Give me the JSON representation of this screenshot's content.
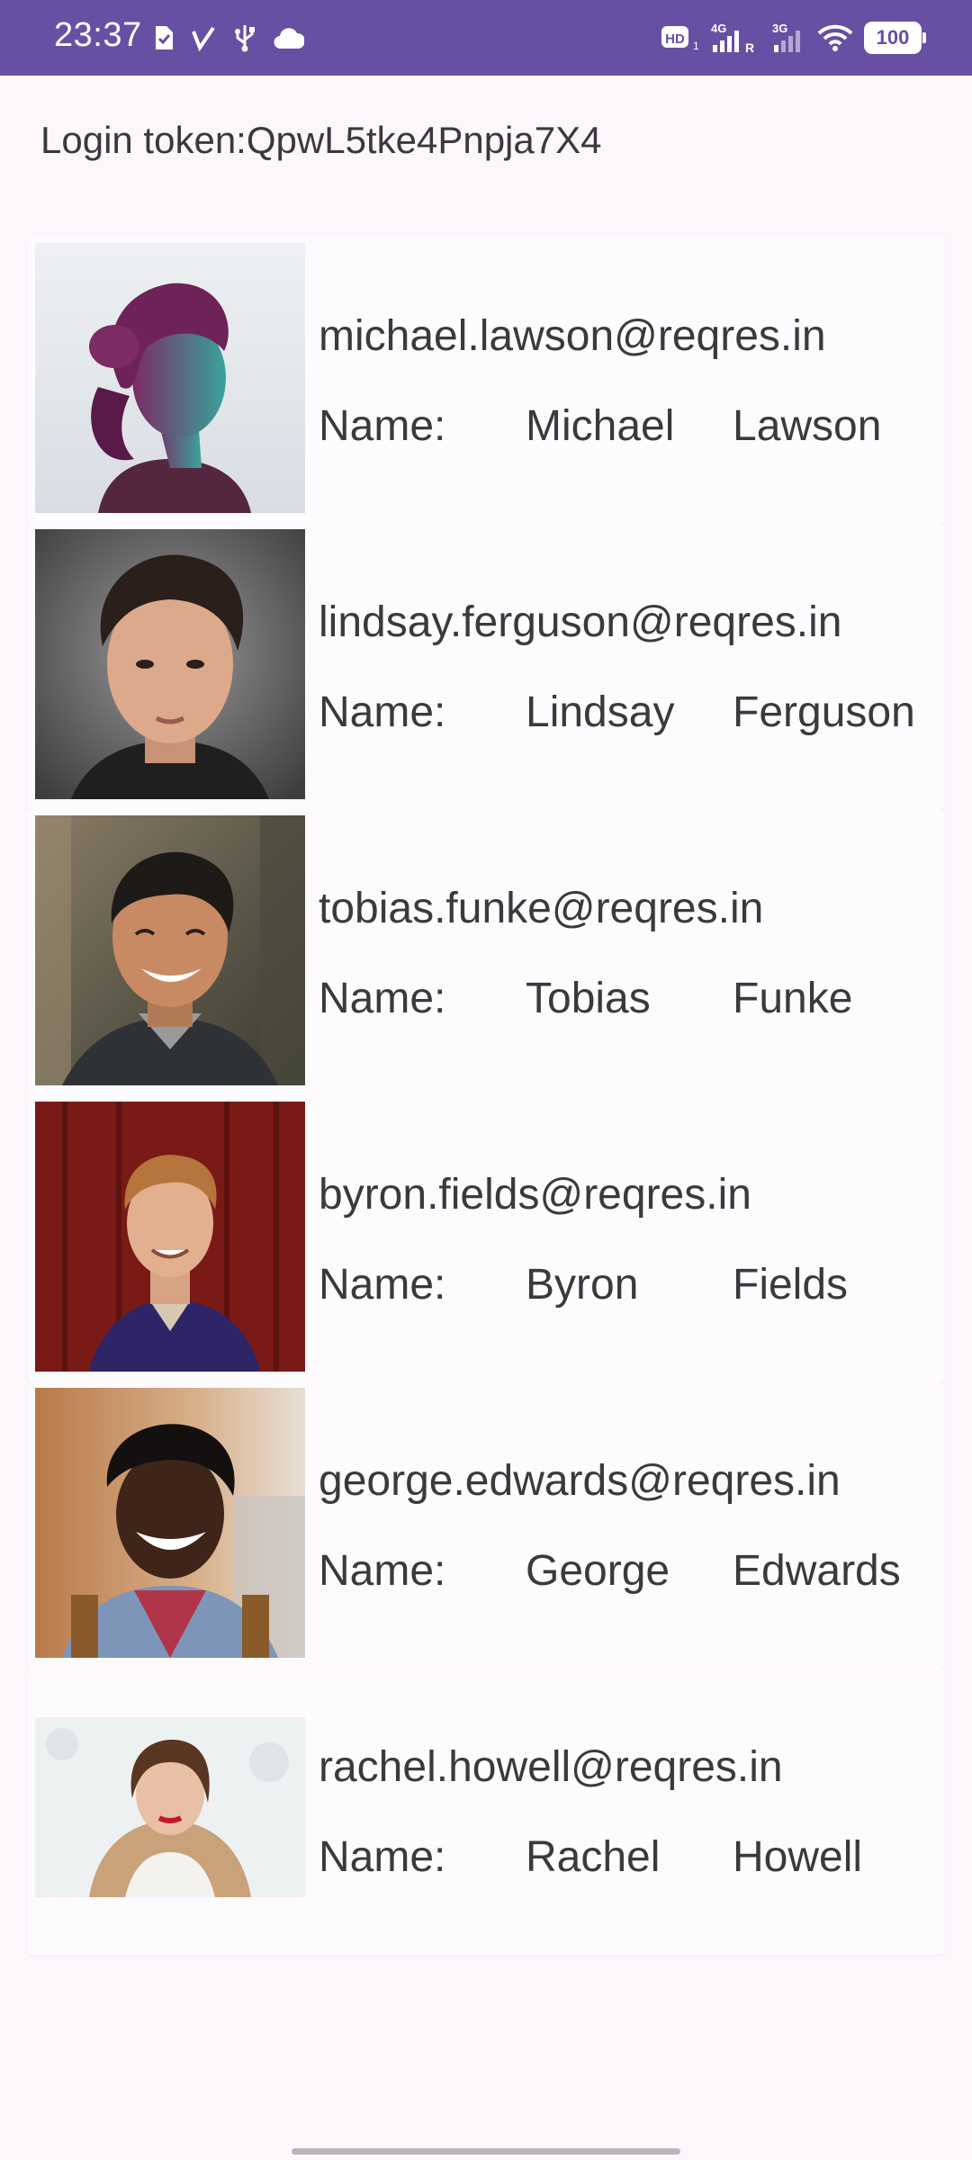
{
  "status_bar": {
    "time": "23:37",
    "battery": "100",
    "network_4g": "4G",
    "network_3g": "3G",
    "hd_badge": "HD",
    "roaming": "R",
    "icons": [
      "sim-card-icon",
      "check-icon",
      "usb-icon",
      "cloud-icon",
      "hd-icon",
      "signal-4g-icon",
      "signal-3g-icon",
      "wifi-icon",
      "battery-icon"
    ],
    "background_color": "#6750a4"
  },
  "login": {
    "label": "Login token:",
    "token": "QpwL5tke4Pnpja7X4"
  },
  "users": [
    {
      "email": "michael.lawson@reqres.in",
      "name_label": "Name:",
      "first_name": "Michael",
      "last_name": "Lawson"
    },
    {
      "email": "lindsay.ferguson@reqres.in",
      "name_label": "Name:",
      "first_name": "Lindsay",
      "last_name": "Ferguson"
    },
    {
      "email": "tobias.funke@reqres.in",
      "name_label": "Name:",
      "first_name": "Tobias",
      "last_name": "Funke"
    },
    {
      "email": "byron.fields@reqres.in",
      "name_label": "Name:",
      "first_name": "Byron",
      "last_name": "Fields"
    },
    {
      "email": "george.edwards@reqres.in",
      "name_label": "Name:",
      "first_name": "George",
      "last_name": "Edwards"
    },
    {
      "email": "rachel.howell@reqres.in",
      "name_label": "Name:",
      "first_name": "Rachel",
      "last_name": "Howell"
    }
  ]
}
